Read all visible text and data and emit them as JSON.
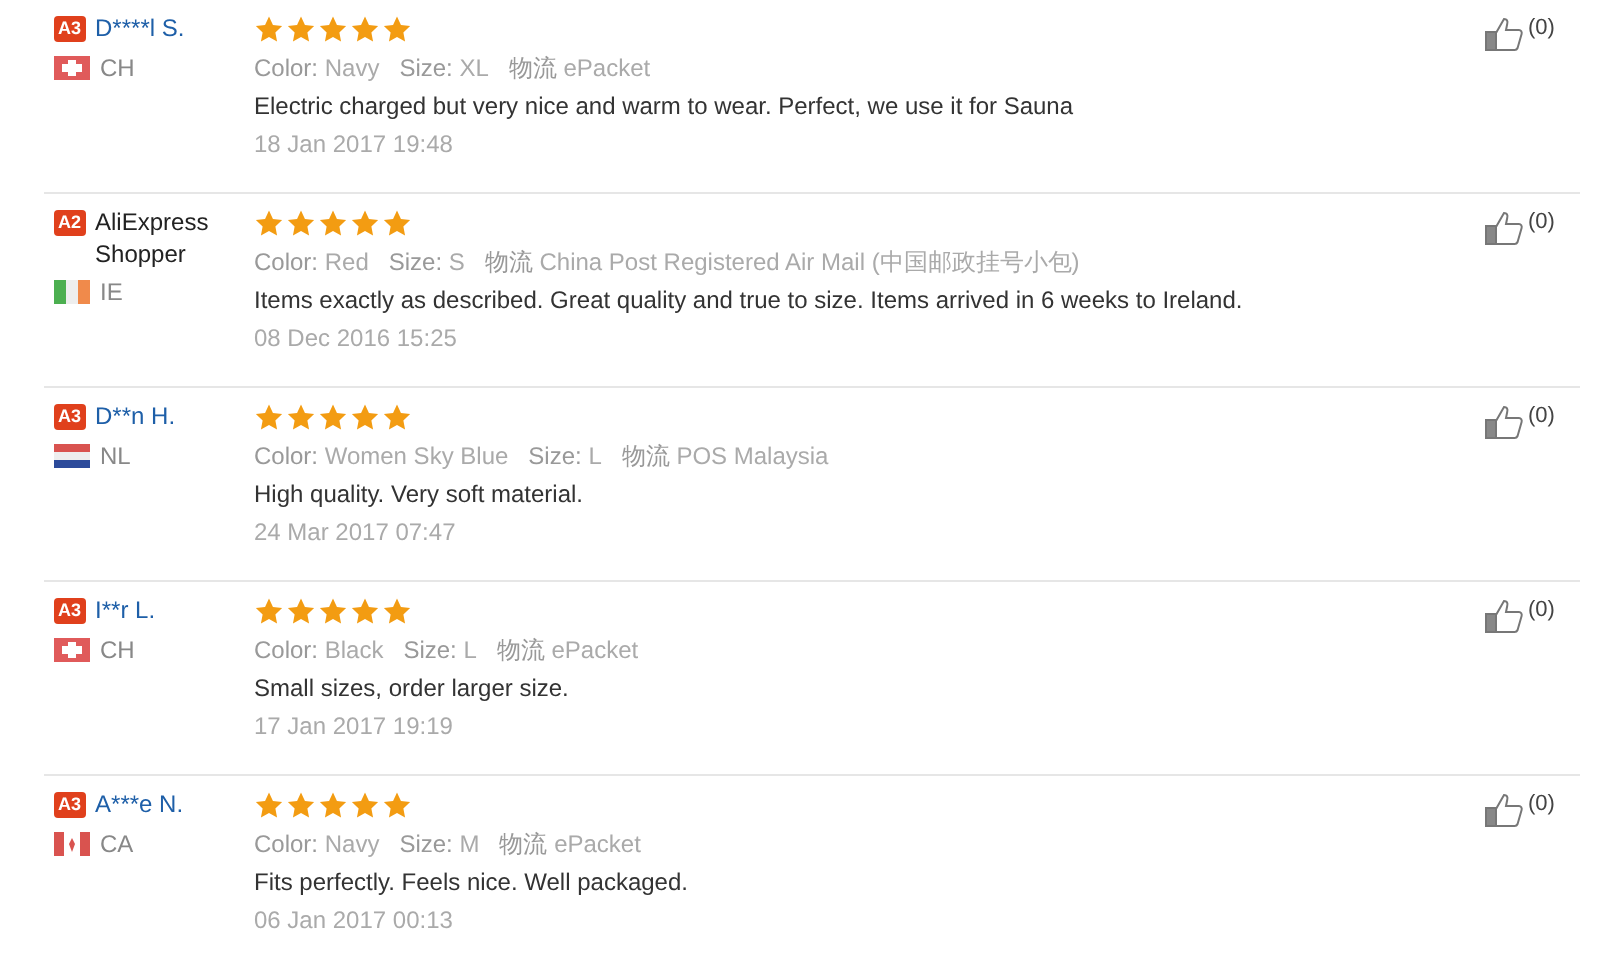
{
  "reviews": [
    {
      "level_badge": "A3",
      "name": "D****l S.",
      "flag": {
        "kind": "cross"
      },
      "country": "CH",
      "stars": 5,
      "meta": [
        {
          "label": "Color:",
          "value": "Navy"
        },
        {
          "label": "Size:",
          "value": "XL"
        },
        {
          "label": "物流",
          "value": "ePacket"
        }
      ],
      "text": "Electric charged but very nice and warm to wear. Perfect, we use it for Sauna",
      "date": "18 Jan 2017 19:48",
      "likes": "(0)"
    },
    {
      "level_badge": "A2",
      "name": "AliExpress Shopper",
      "flag": {
        "kind": "tricolor"
      },
      "country": "IE",
      "stars": 5,
      "meta": [
        {
          "label": "Color:",
          "value": "Red"
        },
        {
          "label": "Size:",
          "value": "S"
        },
        {
          "label": "物流",
          "value": "China Post Registered Air Mail (中国邮政挂号小包)"
        }
      ],
      "text": "Items exactly as described. Great quality and true to size. Items arrived in 6 weeks to Ireland.",
      "date": "08 Dec 2016 15:25",
      "likes": "(0)"
    },
    {
      "level_badge": "A3",
      "name": "D**n H.",
      "flag": {
        "kind": "bands"
      },
      "country": "NL",
      "stars": 5,
      "meta": [
        {
          "label": "Color:",
          "value": "Women Sky Blue"
        },
        {
          "label": "Size:",
          "value": "L"
        },
        {
          "label": "物流",
          "value": "POS Malaysia"
        }
      ],
      "text": "High quality. Very soft material.",
      "date": "24 Mar 2017 07:47",
      "likes": "(0)"
    },
    {
      "level_badge": "A3",
      "name": "I**r L.",
      "flag": {
        "kind": "cross"
      },
      "country": "CH",
      "stars": 5,
      "meta": [
        {
          "label": "Color:",
          "value": "Black"
        },
        {
          "label": "Size:",
          "value": "L"
        },
        {
          "label": "物流",
          "value": "ePacket"
        }
      ],
      "text": "Small sizes, order larger size.",
      "date": "17 Jan 2017 19:19",
      "likes": "(0)"
    },
    {
      "level_badge": "A3",
      "name": "A***e N.",
      "flag": {
        "kind": "leaf"
      },
      "country": "CA",
      "stars": 5,
      "meta": [
        {
          "label": "Color:",
          "value": "Navy"
        },
        {
          "label": "Size:",
          "value": "M"
        },
        {
          "label": "物流",
          "value": "ePacket"
        }
      ],
      "text": "Fits perfectly. Feels nice. Well packaged.",
      "date": "06 Jan 2017 00:13",
      "likes": "(0)"
    }
  ]
}
